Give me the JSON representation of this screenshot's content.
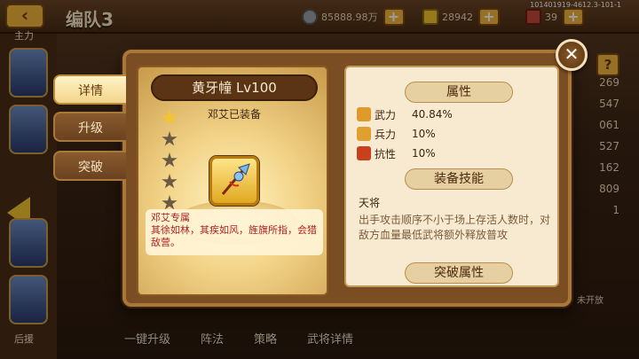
{
  "header": {
    "back_icon": "back-arrow-icon",
    "title": "编队3",
    "silver": "85888.98万",
    "gold": "28942",
    "food": "39",
    "version": "101401919-4612.3-101-1"
  },
  "left_column": {
    "top_label": "主力",
    "bottom_label": "后援"
  },
  "bottom_bar": [
    "一键升级",
    "阵法",
    "策略",
    "武将详情"
  ],
  "right_side": {
    "stats": [
      "269",
      "547",
      "061",
      "527",
      "162",
      "809",
      "1"
    ],
    "not_open": "未开放"
  },
  "modal": {
    "close_icon": "close-icon",
    "tabs": [
      {
        "label": "详情",
        "active": true
      },
      {
        "label": "升级",
        "active": false
      },
      {
        "label": "突破",
        "active": false
      }
    ],
    "item": {
      "name": "黄牙幢  Lv100",
      "equipped_by": "邓艾已装备",
      "stars_total": 5,
      "stars_filled": 1,
      "icon": "spear-icon",
      "exclusive_title": "邓艾专属",
      "flavor_text": "其徐如林，其疾如风，旌旗所指，会猎敌营。"
    },
    "attributes": {
      "header": "属性",
      "rows": [
        {
          "label": "武力",
          "value": "40.84%",
          "icon": "force-icon",
          "color": "#e09a2a"
        },
        {
          "label": "兵力",
          "value": "10%",
          "icon": "troops-icon",
          "color": "#e0a030"
        },
        {
          "label": "抗性",
          "value": "10%",
          "icon": "resist-icon",
          "color": "#c8401c"
        }
      ]
    },
    "skill": {
      "header": "装备技能",
      "name": "天将",
      "description": "出手攻击顺序不小于场上存活人数时，对敌方血量最低武将额外释放普攻"
    },
    "breakthrough": {
      "header": "突破属性"
    }
  },
  "colors": {
    "accent_gold": "#f2c230",
    "panel_bg": "#f7ead0",
    "frame_brown": "#7a4e22",
    "red_text": "#b02020"
  }
}
